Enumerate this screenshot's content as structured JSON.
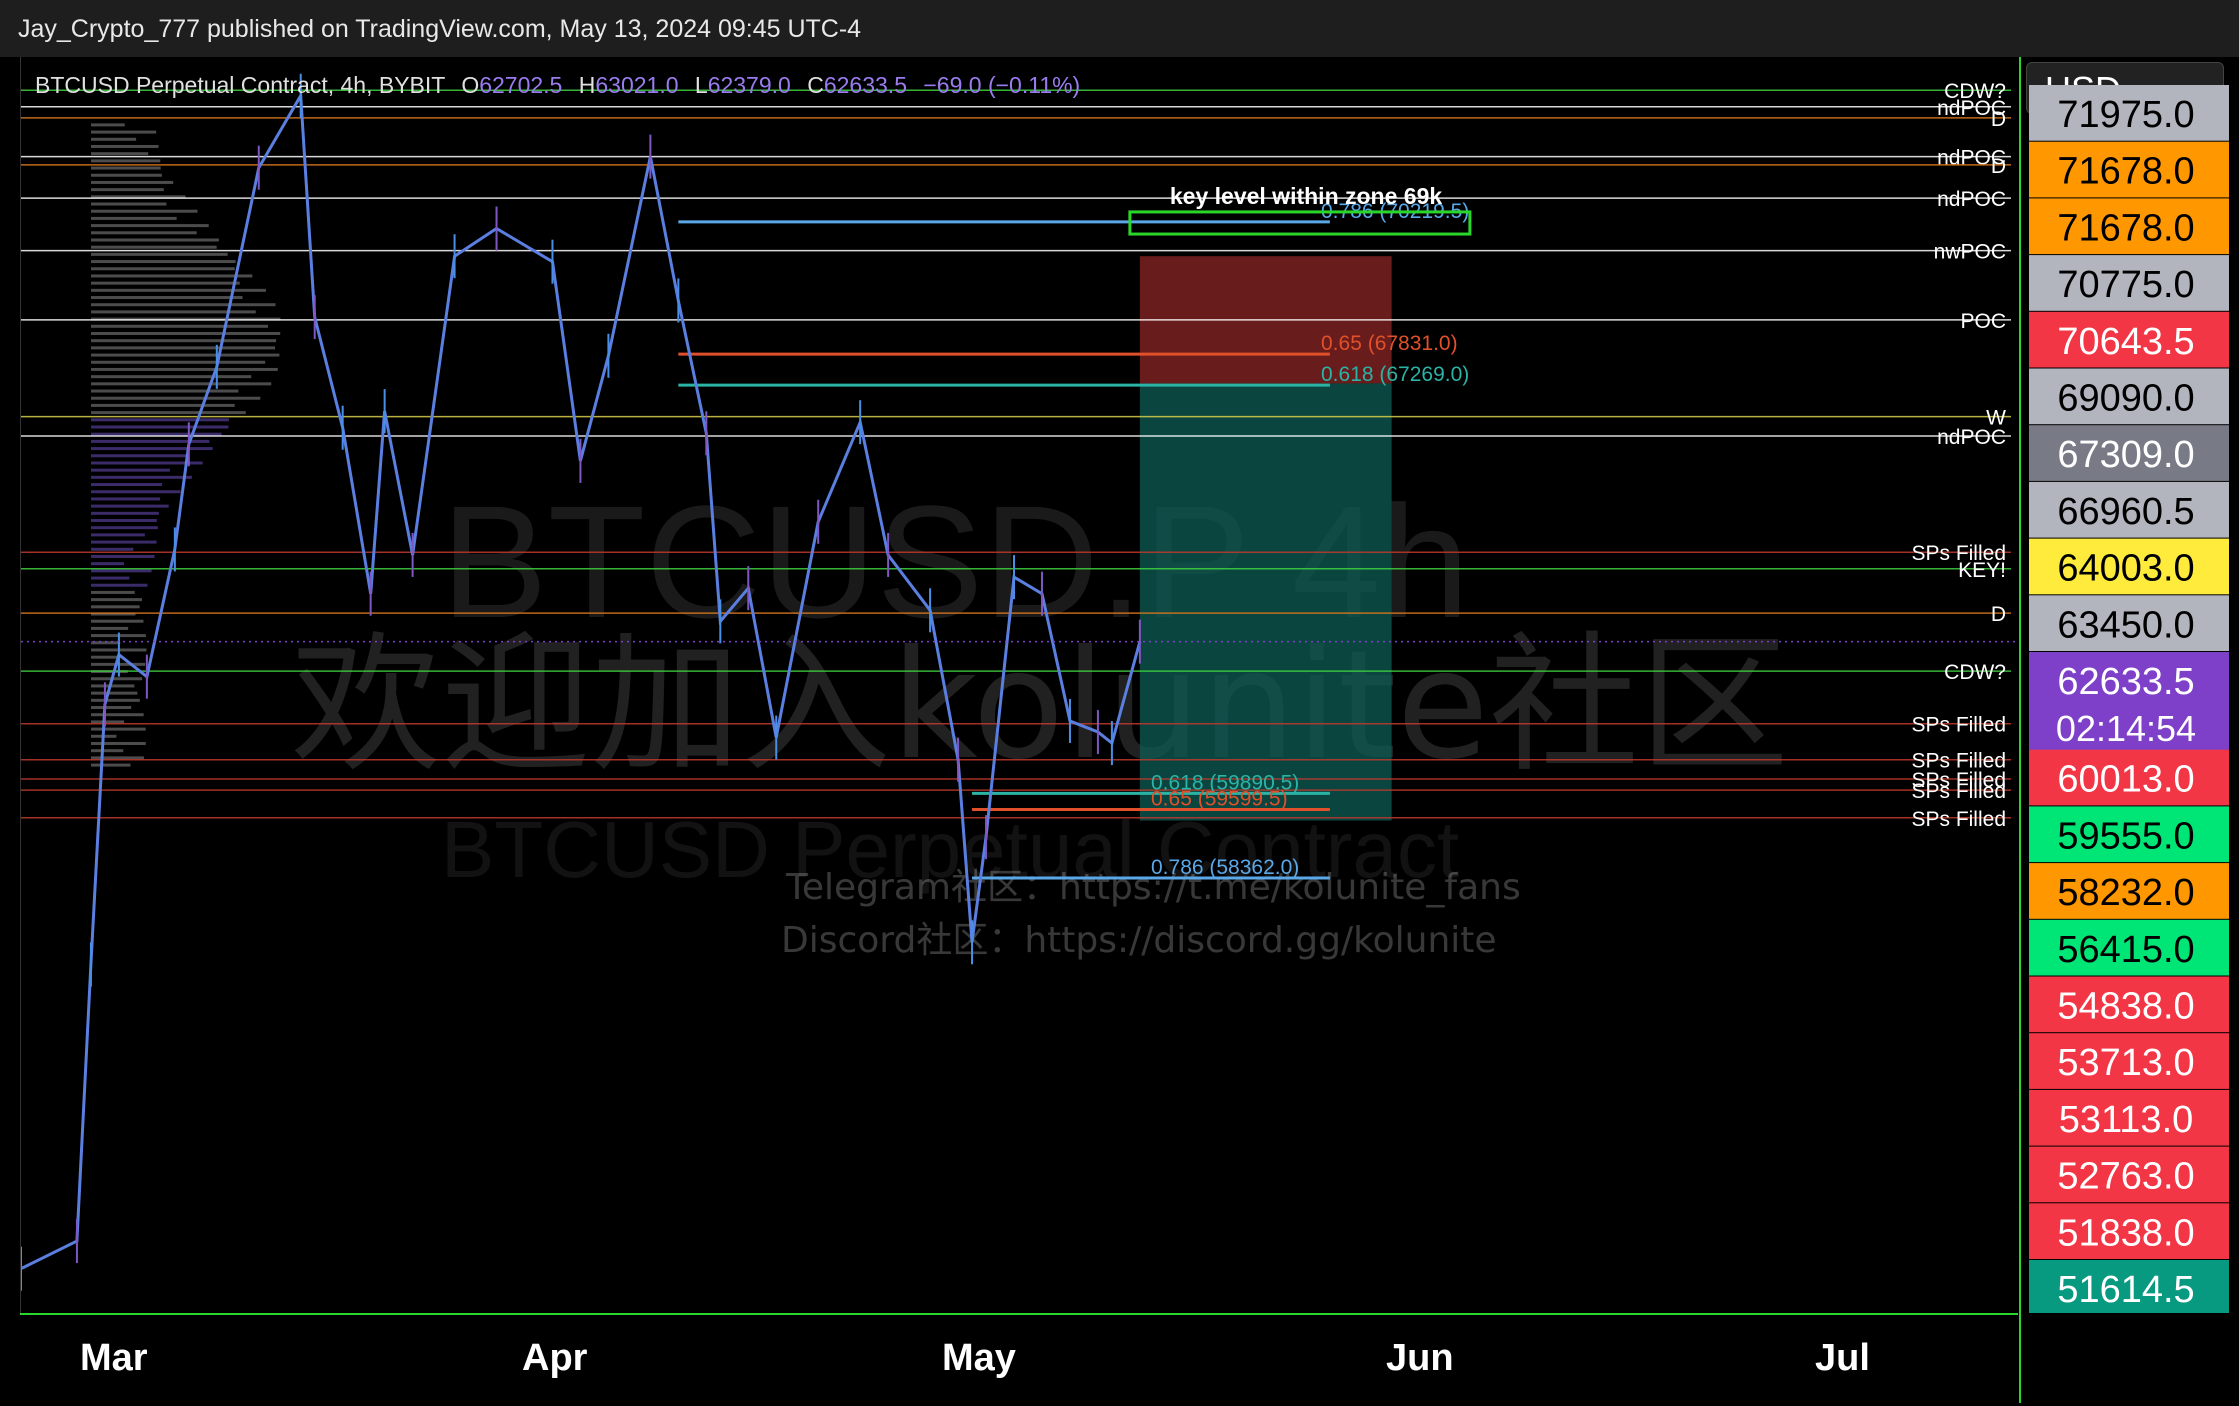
{
  "header": {
    "publisher": "Jay_Crypto_777 published on TradingView.com, May 13, 2024 09:45 UTC-4"
  },
  "legend": {
    "symbol": "BTCUSD Perpetual Contract, 4h, BYBIT",
    "o_label": "O",
    "o": "62702.5",
    "h_label": "H",
    "h": "63021.0",
    "l_label": "L",
    "l": "62379.0",
    "c_label": "C",
    "c": "62633.5",
    "change": "−69.0 (−0.11%)"
  },
  "currency": "USD",
  "watermark": {
    "line1": "BTCUSD.P 4h",
    "line2": "欢迎加入kolunite社区",
    "line3": "BTCUSD Perpetual Contract",
    "telegram": "Telegram社区：https://t.me/kolunite_fans",
    "discord": "Discord社区：https://discord.gg/kolunite"
  },
  "x_axis_labels": [
    "Mar",
    "Apr",
    "May",
    "Jun",
    "Jul"
  ],
  "chart_data": {
    "type": "candlestick",
    "symbol": "BTCUSD Perpetual Contract",
    "timeframe": "4h",
    "x_range": [
      "2024-02-23",
      "2024-07-15"
    ],
    "y_range": [
      50500,
      73200
    ],
    "last_price": 62633.5,
    "countdown": "02:14:54",
    "close_series": [
      {
        "date": "2024-02-23",
        "close": 51300
      },
      {
        "date": "2024-02-27",
        "close": 51800
      },
      {
        "date": "2024-02-28",
        "close": 56800
      },
      {
        "date": "2024-02-29",
        "close": 61500
      },
      {
        "date": "2024-03-01",
        "close": 62400
      },
      {
        "date": "2024-03-03",
        "close": 62000
      },
      {
        "date": "2024-03-05",
        "close": 64300
      },
      {
        "date": "2024-03-06",
        "close": 66200
      },
      {
        "date": "2024-03-08",
        "close": 67600
      },
      {
        "date": "2024-03-11",
        "close": 71200
      },
      {
        "date": "2024-03-14",
        "close": 72500
      },
      {
        "date": "2024-03-15",
        "close": 68500
      },
      {
        "date": "2024-03-17",
        "close": 66500
      },
      {
        "date": "2024-03-19",
        "close": 63500
      },
      {
        "date": "2024-03-20",
        "close": 66800
      },
      {
        "date": "2024-03-22",
        "close": 64200
      },
      {
        "date": "2024-03-25",
        "close": 69600
      },
      {
        "date": "2024-03-28",
        "close": 70100
      },
      {
        "date": "2024-04-01",
        "close": 69500
      },
      {
        "date": "2024-04-03",
        "close": 65900
      },
      {
        "date": "2024-04-05",
        "close": 67800
      },
      {
        "date": "2024-04-08",
        "close": 71400
      },
      {
        "date": "2024-04-10",
        "close": 68800
      },
      {
        "date": "2024-04-12",
        "close": 66400
      },
      {
        "date": "2024-04-13",
        "close": 63000
      },
      {
        "date": "2024-04-15",
        "close": 63600
      },
      {
        "date": "2024-04-17",
        "close": 60900
      },
      {
        "date": "2024-04-20",
        "close": 64800
      },
      {
        "date": "2024-04-23",
        "close": 66600
      },
      {
        "date": "2024-04-25",
        "close": 64200
      },
      {
        "date": "2024-04-28",
        "close": 63200
      },
      {
        "date": "2024-04-30",
        "close": 60500
      },
      {
        "date": "2024-05-01",
        "close": 57200
      },
      {
        "date": "2024-05-02",
        "close": 59100
      },
      {
        "date": "2024-05-04",
        "close": 63800
      },
      {
        "date": "2024-05-06",
        "close": 63500
      },
      {
        "date": "2024-05-08",
        "close": 61200
      },
      {
        "date": "2024-05-10",
        "close": 61000
      },
      {
        "date": "2024-05-11",
        "close": 60800
      },
      {
        "date": "2024-05-13",
        "close": 62633.5
      }
    ],
    "horizontal_levels": [
      {
        "label": "CDW?",
        "price": 72600,
        "color": "#3fd43f"
      },
      {
        "label": "ndPOC",
        "price": 72300,
        "color": "#ffffff"
      },
      {
        "label": "D",
        "price": 72100,
        "color": "#e07a1e"
      },
      {
        "label": "ndPOC",
        "price": 71400,
        "color": "#ffffff"
      },
      {
        "label": "D",
        "price": 71250,
        "color": "#e07a1e"
      },
      {
        "label": "ndPOC",
        "price": 70650,
        "color": "#ffffff"
      },
      {
        "label": "nwPOC",
        "price": 69700,
        "color": "#ffffff"
      },
      {
        "label": "POC",
        "price": 68450,
        "color": "#ffffff"
      },
      {
        "label": "W",
        "price": 66700,
        "color": "#d8d04a"
      },
      {
        "label": "ndPOC",
        "price": 66350,
        "color": "#ffffff"
      },
      {
        "label": "SPs Filled",
        "price": 64250,
        "color": "#c0392b"
      },
      {
        "label": "KEY!",
        "price": 63950,
        "color": "#3fd43f"
      },
      {
        "label": "D",
        "price": 63150,
        "color": "#e07a1e"
      },
      {
        "label": "CDW?",
        "price": 62100,
        "color": "#3fd43f"
      },
      {
        "label": "SPs Filled",
        "price": 61150,
        "color": "#c0392b"
      },
      {
        "label": "SPs Filled",
        "price": 60500,
        "color": "#c0392b"
      },
      {
        "label": "SPs Filled",
        "price": 60150,
        "color": "#c0392b"
      },
      {
        "label": "SPs Filled",
        "price": 59950,
        "color": "#c0392b"
      },
      {
        "label": "SPs Filled",
        "price": 59450,
        "color": "#c0392b"
      }
    ],
    "fib_levels": [
      {
        "label": "0.786 (70219.5)",
        "price": 70219.5,
        "color": "#5aa8e8"
      },
      {
        "label": "0.65 (67831.0)",
        "price": 67831.0,
        "color": "#e0502a"
      },
      {
        "label": "0.618 (67269.0)",
        "price": 67269.0,
        "color": "#2bb3a5"
      },
      {
        "label": "0.618 (59890.5)",
        "price": 59890.5,
        "color": "#2bb3a5"
      },
      {
        "label": "0.65 (59599.5)",
        "price": 59599.5,
        "color": "#e0502a"
      },
      {
        "label": "0.786 (58362.0)",
        "price": 58362.0,
        "color": "#5aa8e8"
      }
    ],
    "position_zones": [
      {
        "kind": "stop",
        "from": 69600,
        "to": 67300,
        "color": "#8b2525"
      },
      {
        "kind": "target",
        "from": 67300,
        "to": 59400,
        "color": "#0d5c55"
      }
    ],
    "annotation": {
      "text": "key level within zone 69k",
      "zone_from": 70400,
      "zone_to": 70000,
      "color": "#2bd62b"
    },
    "price_axis_tags": [
      {
        "text": "71975.0",
        "bg": "#b2b5be",
        "fg": "#000000"
      },
      {
        "text": "71678.0",
        "bg": "#ff9800",
        "fg": "#000000"
      },
      {
        "text": "71678.0",
        "bg": "#ff9800",
        "fg": "#000000"
      },
      {
        "text": "70775.0",
        "bg": "#b2b5be",
        "fg": "#000000"
      },
      {
        "text": "70643.5",
        "bg": "#f23645",
        "fg": "#ffffff"
      },
      {
        "text": "69090.0",
        "bg": "#b2b5be",
        "fg": "#000000"
      },
      {
        "text": "67309.0",
        "bg": "#787b86",
        "fg": "#ffffff"
      },
      {
        "text": "66960.5",
        "bg": "#b2b5be",
        "fg": "#000000"
      },
      {
        "text": "64003.0",
        "bg": "#ffeb3b",
        "fg": "#000000"
      },
      {
        "text": "63450.0",
        "bg": "#b2b5be",
        "fg": "#000000"
      },
      {
        "text": "62633.5",
        "bg": "#7e3fc9",
        "fg": "#ffffff"
      },
      {
        "text": "60013.0",
        "bg": "#f23645",
        "fg": "#ffffff"
      },
      {
        "text": "59555.0",
        "bg": "#00e676",
        "fg": "#000000"
      },
      {
        "text": "58232.0",
        "bg": "#ff9800",
        "fg": "#000000"
      },
      {
        "text": "56415.0",
        "bg": "#00e676",
        "fg": "#000000"
      },
      {
        "text": "54838.0",
        "bg": "#f23645",
        "fg": "#ffffff"
      },
      {
        "text": "53713.0",
        "bg": "#f23645",
        "fg": "#ffffff"
      },
      {
        "text": "53113.0",
        "bg": "#f23645",
        "fg": "#ffffff"
      },
      {
        "text": "52763.0",
        "bg": "#f23645",
        "fg": "#ffffff"
      },
      {
        "text": "51838.0",
        "bg": "#f23645",
        "fg": "#ffffff"
      },
      {
        "text": "51614.5",
        "bg": "#089981",
        "fg": "#ffffff"
      }
    ]
  }
}
